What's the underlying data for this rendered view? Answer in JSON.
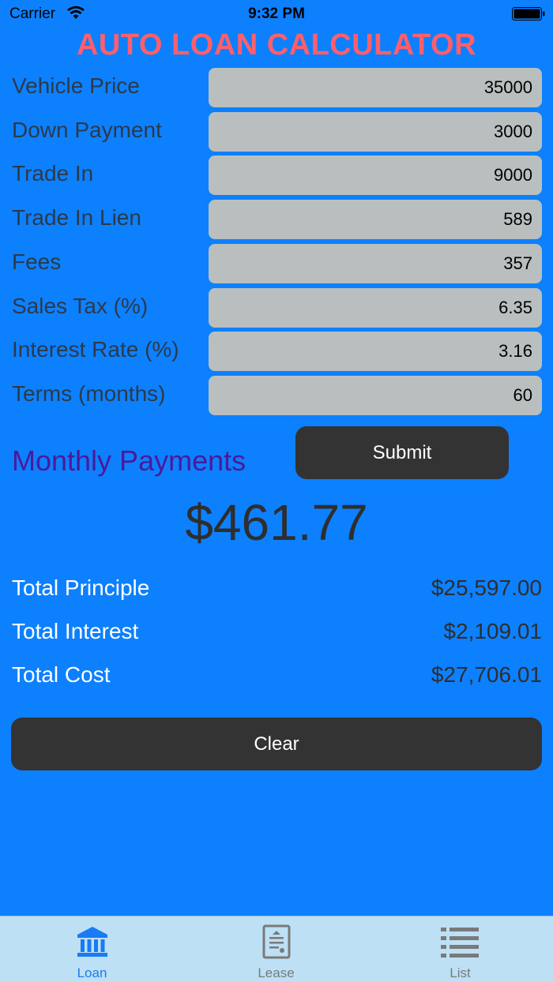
{
  "status": {
    "carrier": "Carrier",
    "time": "9:32 PM"
  },
  "app": {
    "title": "AUTO LOAN CALCULATOR"
  },
  "form": {
    "fields": [
      {
        "label": "Vehicle Price",
        "value": "35000"
      },
      {
        "label": "Down Payment",
        "value": "3000"
      },
      {
        "label": "Trade In",
        "value": "9000"
      },
      {
        "label": "Trade In Lien",
        "value": "589"
      },
      {
        "label": "Fees",
        "value": "357"
      },
      {
        "label": "Sales Tax (%)",
        "value": "6.35"
      },
      {
        "label": "Interest Rate (%)",
        "value": "3.16"
      },
      {
        "label": "Terms (months)",
        "value": "60"
      }
    ]
  },
  "results": {
    "monthly_label": "Monthly Payments",
    "submit_label": "Submit",
    "monthly_value": "$461.77",
    "summary": [
      {
        "label": "Total Principle",
        "value": "$25,597.00"
      },
      {
        "label": "Total Interest",
        "value": "$2,109.01"
      },
      {
        "label": "Total Cost",
        "value": "$27,706.01"
      }
    ],
    "clear_label": "Clear"
  },
  "tabs": [
    {
      "label": "Loan",
      "icon": "bank-icon",
      "active": true
    },
    {
      "label": "Lease",
      "icon": "document-icon",
      "active": false
    },
    {
      "label": "List",
      "icon": "list-icon",
      "active": false
    }
  ],
  "colors": {
    "background": "#0d80fe",
    "title": "#ff5f6b",
    "monthly_label": "#4b1a99",
    "tab_active": "#1a7bf2",
    "tab_inactive": "#7a7a7a"
  }
}
